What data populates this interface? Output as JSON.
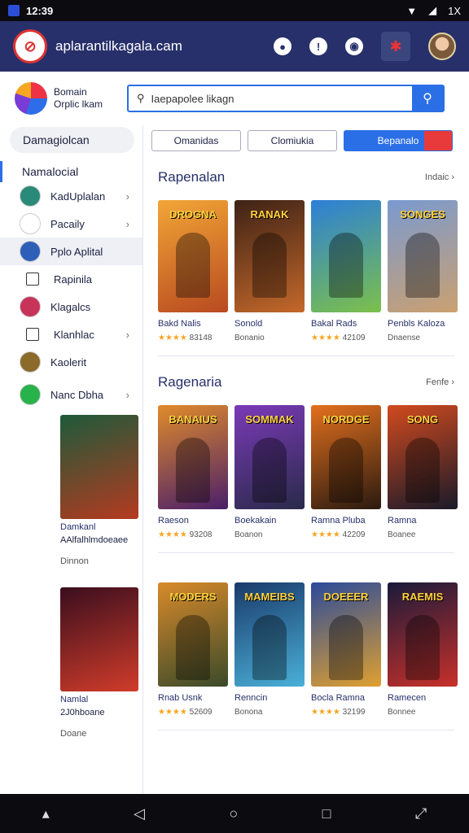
{
  "status": {
    "time": "12:39",
    "battery": "1X"
  },
  "topbar": {
    "url": "aplarantilkagala.cam"
  },
  "brand": {
    "line1": "Bomain",
    "line2": "Orplic lkam"
  },
  "search": {
    "placeholder": "Iaepapolee likagn"
  },
  "sidebar": {
    "selected": "Damagiolcan",
    "header": "Namalocial",
    "items": [
      {
        "label": "KadUplalan",
        "chevron": true,
        "color": "#2a8a7a"
      },
      {
        "label": "Pacaily",
        "chevron": true,
        "color": "#ffffff"
      },
      {
        "label": "Pplo Aplital",
        "chevron": false,
        "color": "#2d5fb8"
      },
      {
        "label": "Rapinila",
        "chevron": false,
        "color": ""
      },
      {
        "label": "Klagalcs",
        "chevron": false,
        "color": "#c8335a"
      },
      {
        "label": "Klanhlac",
        "chevron": true,
        "color": ""
      },
      {
        "label": "Kaolerit",
        "chevron": false,
        "color": "#8b6a2a"
      },
      {
        "label": "Nanc Dbha",
        "chevron": true,
        "color": "#28b24a"
      }
    ],
    "cards": [
      {
        "title": "Damkanl",
        "sub": "AAlfalhlmdoeaee",
        "meta": "Dinnon",
        "art": [
          "#1d5a3a",
          "#b53a20"
        ]
      },
      {
        "title": "Namlal",
        "sub": "2J0hboane",
        "meta": "Doane",
        "art": [
          "#3a0e1e",
          "#d13c2a"
        ]
      }
    ]
  },
  "tabs": [
    "Omanidas",
    "Clomiukia",
    "Bepanalo"
  ],
  "sections": [
    {
      "title": "Rapenalan",
      "more": "Indaic",
      "cards": [
        {
          "label": "DROGNA",
          "name": "Bakd Nalis",
          "sub": "83148",
          "art": [
            "#f2a637",
            "#b84a20"
          ]
        },
        {
          "label": "RANAK",
          "name": "Sonold",
          "sub": "Bonanio",
          "art": [
            "#3d2216",
            "#c4682a"
          ]
        },
        {
          "label": "",
          "name": "Bakal Rads",
          "sub": "42109",
          "art": [
            "#2c7fd8",
            "#7cc04a"
          ]
        },
        {
          "label": "SONGES",
          "name": "Penbls Kaloza",
          "sub": "Dnaense",
          "art": [
            "#7a9ad0",
            "#caa070"
          ]
        }
      ]
    },
    {
      "title": "Ragenaria",
      "more": "Fenfe",
      "cards": [
        {
          "label": "BANAIUS",
          "name": "Raeson",
          "sub": "93208",
          "art": [
            "#e08b2a",
            "#4a1e6a"
          ]
        },
        {
          "label": "SOMMAK",
          "name": "Boekakain",
          "sub": "Boanon",
          "art": [
            "#7a3ab8",
            "#2a2a4a"
          ]
        },
        {
          "label": "NORDGE",
          "name": "Ramna Pluba",
          "sub": "42209",
          "art": [
            "#e3701e",
            "#2a1a10"
          ]
        },
        {
          "label": "SONG",
          "name": "Ramna",
          "sub": "Boanee",
          "art": [
            "#d14a1e",
            "#1a1a2a"
          ]
        }
      ]
    },
    {
      "title": "",
      "more": "",
      "cards": [
        {
          "label": "MODERS",
          "name": "Rnab Usnk",
          "sub": "52609",
          "art": [
            "#d88a2a",
            "#3a4a2a"
          ]
        },
        {
          "label": "MAMEIBS",
          "name": "Renncin",
          "sub": "Bonona",
          "art": [
            "#1a3a6a",
            "#4ab0d8"
          ]
        },
        {
          "label": "DOEEER",
          "name": "Bocla Ramna",
          "sub": "32199",
          "art": [
            "#2a4a9a",
            "#e0a030"
          ]
        },
        {
          "label": "RAEMIS",
          "name": "Ramecen",
          "sub": "Bonnee",
          "art": [
            "#1a1a3a",
            "#c8302a"
          ]
        }
      ]
    }
  ]
}
